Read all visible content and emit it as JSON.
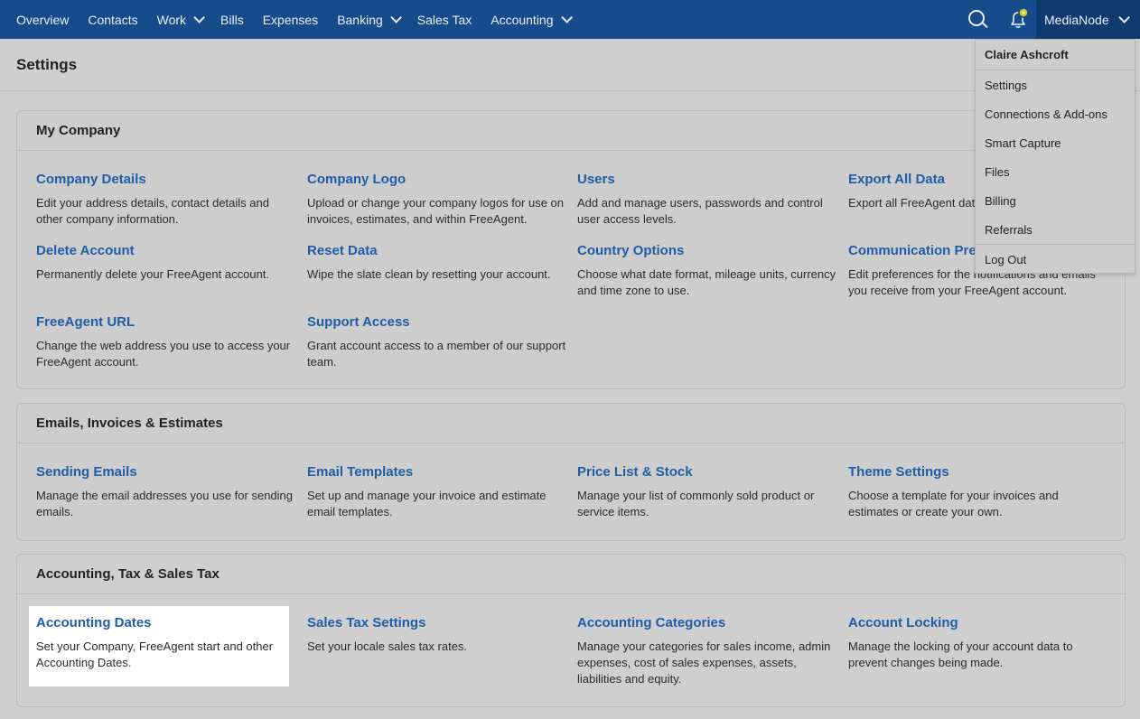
{
  "nav": {
    "items": [
      {
        "label": "Overview",
        "dropdown": false
      },
      {
        "label": "Contacts",
        "dropdown": false
      },
      {
        "label": "Work",
        "dropdown": true
      },
      {
        "label": "Bills",
        "dropdown": false
      },
      {
        "label": "Expenses",
        "dropdown": false
      },
      {
        "label": "Banking",
        "dropdown": true
      },
      {
        "label": "Sales Tax",
        "dropdown": false
      },
      {
        "label": "Accounting",
        "dropdown": true
      }
    ],
    "account_label": "MediaNode"
  },
  "page": {
    "title": "Settings"
  },
  "sections": [
    {
      "title": "My Company",
      "items": [
        {
          "title": "Company Details",
          "desc": "Edit your address details, contact details and other company information."
        },
        {
          "title": "Company Logo",
          "desc": "Upload or change your company logos for use on invoices, estimates, and within FreeAgent."
        },
        {
          "title": "Users",
          "desc": "Add and manage users, passwords and control user access levels."
        },
        {
          "title": "Export All Data",
          "desc": "Export all FreeAgent data in Excel (XLSX) format."
        },
        {
          "title": "Delete Account",
          "desc": "Permanently delete your FreeAgent account."
        },
        {
          "title": "Reset Data",
          "desc": "Wipe the slate clean by resetting your account."
        },
        {
          "title": "Country Options",
          "desc": "Choose what date format, mileage units, currency and time zone to use."
        },
        {
          "title": "Communication Preferences",
          "desc": "Edit preferences for the notifications and emails you receive from your FreeAgent account."
        },
        {
          "title": "FreeAgent URL",
          "desc": "Change the web address you use to access your FreeAgent account."
        },
        {
          "title": "Support Access",
          "desc": "Grant account access to a member of our support team."
        }
      ]
    },
    {
      "title": "Emails, Invoices & Estimates",
      "items": [
        {
          "title": "Sending Emails",
          "desc": "Manage the email addresses you use for sending emails."
        },
        {
          "title": "Email Templates",
          "desc": "Set up and manage your invoice and estimate email templates."
        },
        {
          "title": "Price List & Stock",
          "desc": "Manage your list of commonly sold product or service items."
        },
        {
          "title": "Theme Settings",
          "desc": "Choose a template for your invoices and estimates or create your own."
        }
      ]
    },
    {
      "title": "Accounting, Tax & Sales Tax",
      "items": [
        {
          "title": "Accounting Dates",
          "desc": "Set your Company, FreeAgent start and other Accounting Dates."
        },
        {
          "title": "Sales Tax Settings",
          "desc": "Set your locale sales tax rates."
        },
        {
          "title": "Accounting Categories",
          "desc": "Manage your categories for sales income, admin expenses, cost of sales expenses, assets, liabilities and equity."
        },
        {
          "title": "Account Locking",
          "desc": "Manage the locking of your account data to prevent changes being made."
        }
      ]
    }
  ],
  "account_menu": {
    "user_name": "Claire Ashcroft",
    "items": [
      "Settings",
      "Connections & Add-ons",
      "Smart Capture",
      "Files",
      "Billing",
      "Referrals"
    ],
    "logout": "Log Out"
  },
  "colors": {
    "nav_bg": "#174c8c",
    "link": "#1f5ea7",
    "account_bg": "#0f3b70"
  }
}
